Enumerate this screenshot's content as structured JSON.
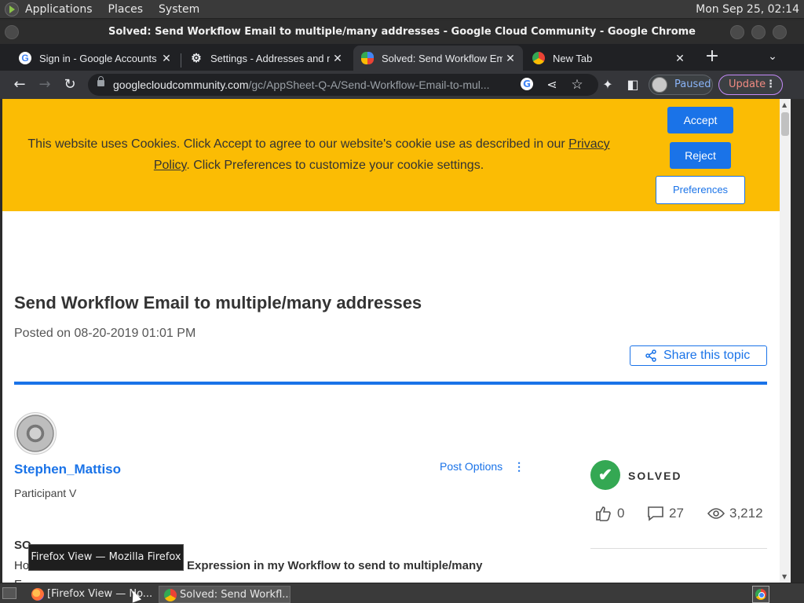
{
  "top_panel": {
    "menus": [
      "Applications",
      "Places",
      "System"
    ],
    "clock": "Mon Sep 25, 02:14"
  },
  "window": {
    "title": "Solved: Send Workflow Email to multiple/many addresses - Google Cloud Community - Google Chrome"
  },
  "tabs": [
    {
      "label": "Sign in - Google Accounts",
      "icon": "google-g-icon"
    },
    {
      "label": "Settings - Addresses and m",
      "icon": "gear-icon"
    },
    {
      "label": "Solved: Send Workflow Em",
      "icon": "google-cloud-icon"
    },
    {
      "label": "New Tab",
      "icon": "chrome-icon"
    }
  ],
  "address_bar": {
    "host": "googlecloudcommunity.com",
    "path": "/gc/AppSheet-Q-A/Send-Workflow-Email-to-mul..."
  },
  "profile": {
    "label": "Paused"
  },
  "update": {
    "label": "Update"
  },
  "cookie_banner": {
    "text_before_link": "This website uses Cookies. Click Accept to agree to our website's cookie use as described in our ",
    "link_part1": "Privacy",
    "link_part2": "Policy",
    "text_after_link": ". Click Preferences to customize your cookie settings.",
    "accept": "Accept",
    "reject": "Reject",
    "preferences": "Preferences"
  },
  "topic": {
    "title": "Send Workflow Email to multiple/many addresses",
    "posted": "Posted on 08-20-2019 01:01 PM",
    "share": "Share this topic"
  },
  "post": {
    "author": "Stephen_Mattiso",
    "rank": "Participant V",
    "options": "Post Options",
    "body_line1": "SO",
    "body_line2_start": "Ho",
    "body_line2_bold": "o” Expression in my Workflow to send to multiple/many",
    "body_line3": "E"
  },
  "status": {
    "solved": "SOLVED",
    "likes": "0",
    "replies": "27",
    "views": "3,212"
  },
  "tooltip": "Firefox View — Mozilla Firefox",
  "taskbar": {
    "items": [
      {
        "label": "[Firefox View — No..."
      },
      {
        "label": "Solved: Send Workfl..."
      }
    ]
  }
}
